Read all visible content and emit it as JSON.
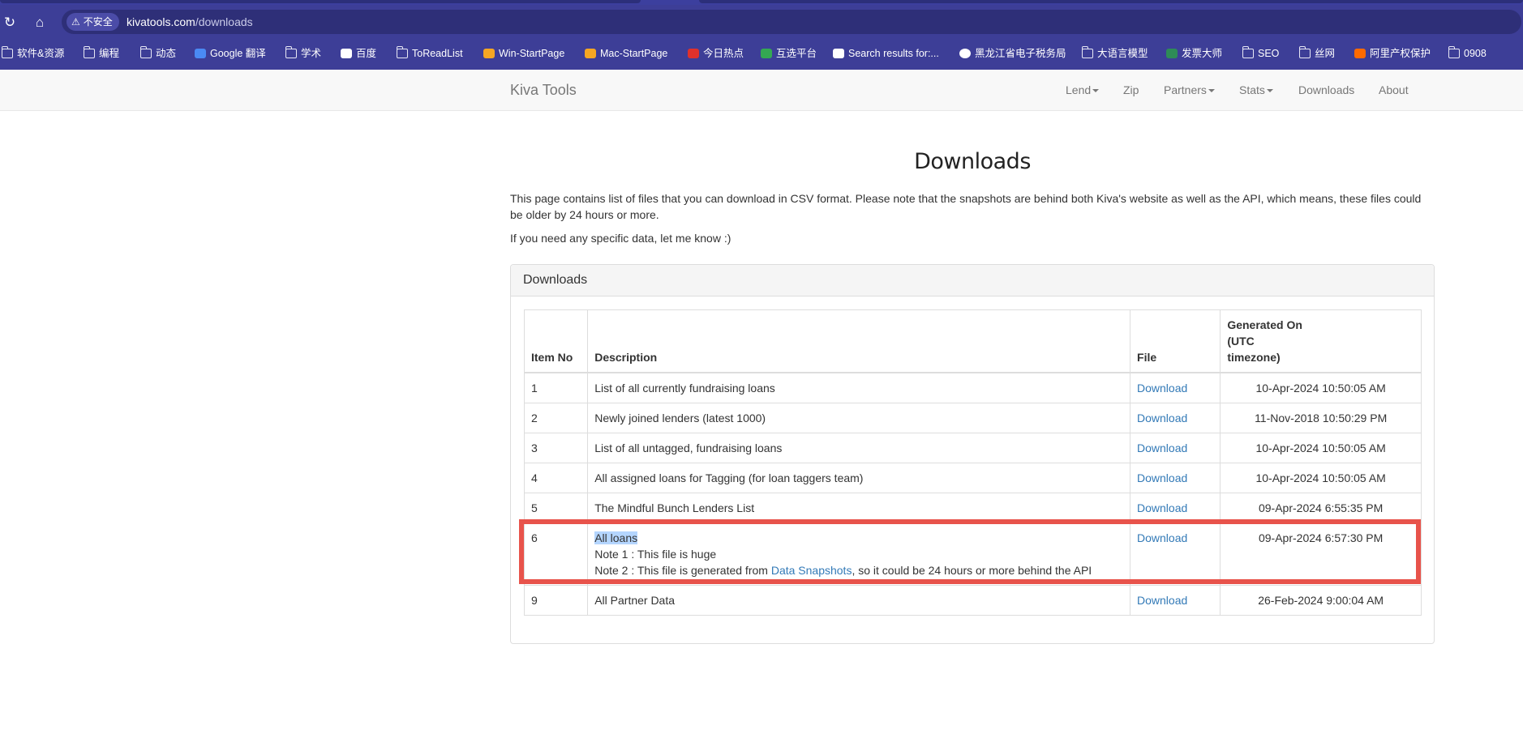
{
  "browser": {
    "insecure_label": "不安全",
    "url_host": "kivatools.com",
    "url_path": "/downloads",
    "bookmarks": [
      {
        "label": "软件&资源",
        "icon": "folder-icon"
      },
      {
        "label": "编程",
        "icon": "folder-icon"
      },
      {
        "label": "动态",
        "icon": "folder-icon"
      },
      {
        "label": "Google 翻译",
        "icon": "google-translate-icon"
      },
      {
        "label": "学术",
        "icon": "folder-icon"
      },
      {
        "label": "百度",
        "icon": "baidu-icon"
      },
      {
        "label": "ToReadList",
        "icon": "folder-icon"
      },
      {
        "label": "Win-StartPage",
        "icon": "home-icon"
      },
      {
        "label": "Mac-StartPage",
        "icon": "home-icon"
      },
      {
        "label": "今日热点",
        "icon": "r-icon"
      },
      {
        "label": "互选平台",
        "icon": "hx-icon"
      },
      {
        "label": "Search results for:...",
        "icon": "site-icon"
      },
      {
        "label": "黑龙江省电子税务局",
        "icon": "globe-icon"
      },
      {
        "label": "大语言模型",
        "icon": "folder-icon"
      },
      {
        "label": "发票大师",
        "icon": "invoice-icon"
      },
      {
        "label": "SEO",
        "icon": "folder-icon"
      },
      {
        "label": "丝网",
        "icon": "folder-icon"
      },
      {
        "label": "阿里产权保护",
        "icon": "ali-icon"
      },
      {
        "label": "0908",
        "icon": "folder-icon"
      }
    ]
  },
  "site": {
    "brand": "Kiva Tools",
    "nav": [
      {
        "label": "Lend",
        "dropdown": true
      },
      {
        "label": "Zip",
        "dropdown": false
      },
      {
        "label": "Partners",
        "dropdown": true
      },
      {
        "label": "Stats",
        "dropdown": true
      },
      {
        "label": "Downloads",
        "dropdown": false
      },
      {
        "label": "About",
        "dropdown": false
      }
    ]
  },
  "page": {
    "title": "Downloads",
    "intro": "This page contains list of files that you can download in CSV format. Please note that the snapshots are behind both Kiva's website as well as the API, which means, these files could be older by 24 hours or more.",
    "intro2": "If you need any specific data, let me know :)",
    "panel_title": "Downloads",
    "table": {
      "headers": {
        "item_no": "Item No",
        "description": "Description",
        "file": "File",
        "generated_line1": "Generated On",
        "generated_line2": "(UTC",
        "generated_line3": "timezone)"
      },
      "rows": [
        {
          "no": "1",
          "desc": "List of all currently fundraising loans",
          "file": "Download",
          "generated": "10-Apr-2024 10:50:05 AM"
        },
        {
          "no": "2",
          "desc": "Newly joined lenders (latest 1000)",
          "file": "Download",
          "generated": "11-Nov-2018 10:50:29 PM"
        },
        {
          "no": "3",
          "desc": "List of all untagged, fundraising loans",
          "file": "Download",
          "generated": "10-Apr-2024 10:50:05 AM"
        },
        {
          "no": "4",
          "desc": "All assigned loans for Tagging (for loan taggers team)",
          "file": "Download",
          "generated": "10-Apr-2024 10:50:05 AM"
        },
        {
          "no": "5",
          "desc": "The Mindful Bunch Lenders List",
          "file": "Download",
          "generated": "09-Apr-2024 6:55:35 PM"
        },
        {
          "no": "6",
          "desc": "All loans",
          "note1": "Note 1 : This file is huge",
          "note2_prefix": "Note 2 : This file is generated from ",
          "note2_link": "Data Snapshots",
          "note2_suffix": ", so it could be 24 hours or more behind the API",
          "file": "Download",
          "generated": "09-Apr-2024 6:57:30 PM"
        },
        {
          "no": "9",
          "desc": "All Partner Data",
          "file": "Download",
          "generated": "26-Feb-2024 9:00:04 AM"
        }
      ]
    }
  },
  "colors": {
    "chrome": "#3d3e97",
    "link": "#337ab7",
    "highlight_box": "#e8534b",
    "selection": "#b4d5fe"
  }
}
